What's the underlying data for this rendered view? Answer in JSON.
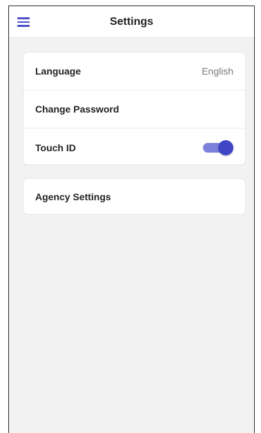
{
  "header": {
    "title": "Settings",
    "menu_icon": "hamburger-menu-icon"
  },
  "settings": {
    "items": [
      {
        "label": "Language",
        "value": "English"
      },
      {
        "label": "Change Password"
      },
      {
        "label": "Touch ID",
        "toggle_on": true
      }
    ]
  },
  "agency": {
    "label": "Agency Settings"
  },
  "colors": {
    "accent": "#4046c4",
    "toggle_track": "#7b80d8",
    "background": "#f2f2f2",
    "card": "#ffffff"
  }
}
